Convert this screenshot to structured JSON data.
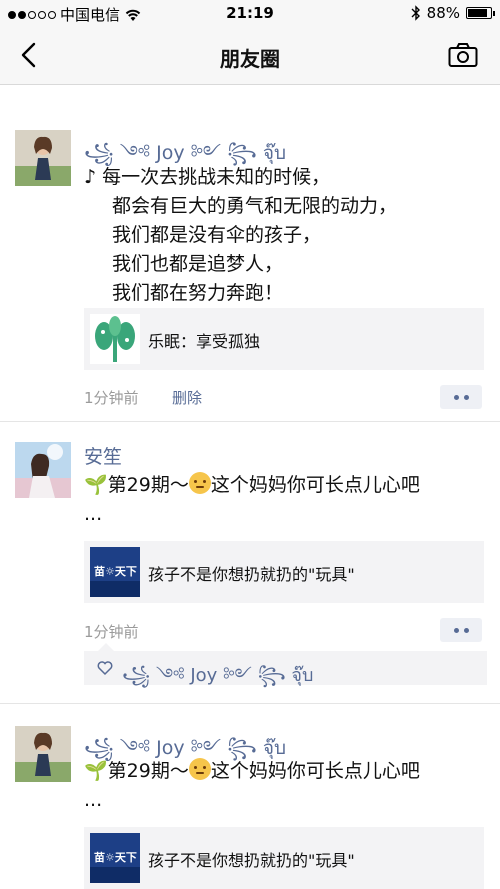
{
  "status_bar": {
    "carrier": "中国电信",
    "time": "21:19",
    "battery": "88%",
    "battery_level": 0.88,
    "signal_bars_filled": 2,
    "signal_bars_total": 5
  },
  "nav": {
    "title": "朋友圈",
    "back_icon": "chevron-left-icon",
    "camera_icon": "camera-icon"
  },
  "colors": {
    "link_blue": "#576b95",
    "card_bg": "#f3f3f5",
    "time_gray": "#9b9b9b",
    "bar_bg": "#f7f7f7"
  },
  "posts": [
    {
      "nickname": "꧁ ༺ Joy ༻ ꧂ จุ๊บ",
      "lines": [
        "♪ 每一次去挑战未知的时候，",
        "都会有巨大的勇气和无限的动力，",
        "我们都是没有伞的孩子，",
        "我们也都是追梦人，",
        "我们都在努力奔跑！"
      ],
      "link_title": "乐眠：享受孤独",
      "time": "1分钟前",
      "delete": "删除"
    },
    {
      "nickname": "安笙",
      "text_before": "🌱第29期～",
      "text_after": "这个妈妈你可长点儿心吧",
      "text_ellipsis": "...",
      "link_title": "孩子不是你想扔就扔的\"玩具\"",
      "time": "1分钟前",
      "liker": "꧁ ༺ Joy ༻ ꧂ จุ๊บ"
    },
    {
      "nickname": "꧁ ༺ Joy ༻ ꧂ จุ๊บ",
      "text_before": "🌱第29期～",
      "text_after": "这个妈妈你可长点儿心吧",
      "text_ellipsis": "...",
      "link_title": "孩子不是你想扔就扔的\"玩具\""
    }
  ]
}
